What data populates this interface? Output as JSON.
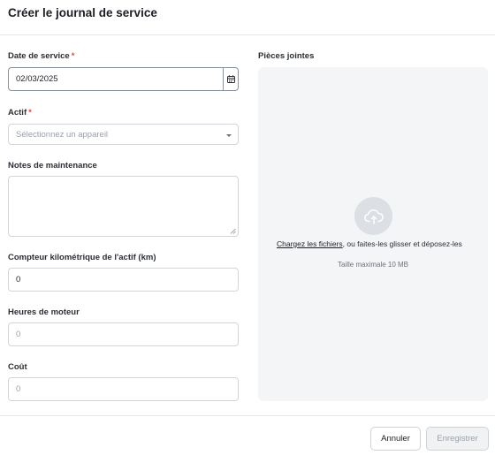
{
  "header": {
    "title": "Créer le journal de service"
  },
  "form": {
    "service_date": {
      "label": "Date de service",
      "required_mark": "*",
      "value": "02/03/2025"
    },
    "asset": {
      "label": "Actif",
      "required_mark": "*",
      "placeholder": "Sélectionnez un appareil"
    },
    "notes": {
      "label": "Notes de maintenance",
      "value": ""
    },
    "odometer": {
      "label": "Compteur kilométrique de l'actif (km)",
      "value": "0"
    },
    "engine_hours": {
      "label": "Heures de moteur",
      "placeholder": "0"
    },
    "cost": {
      "label": "Coût",
      "placeholder": "0"
    }
  },
  "attachments": {
    "label": "Pièces jointes",
    "upload_link": "Chargez les fichiers",
    "upload_text": ", ou faites-les glisser et déposez-les",
    "max_size": "Taille maximale 10 MB",
    "icon": "cloud-upload-icon"
  },
  "footer": {
    "cancel_label": "Annuler",
    "save_label": "Enregistrer"
  },
  "colors": {
    "required": "#e5484d",
    "border": "#d2d6dc",
    "dropzone_bg": "#f4f5f7",
    "disabled_text": "#9aa0a8"
  }
}
